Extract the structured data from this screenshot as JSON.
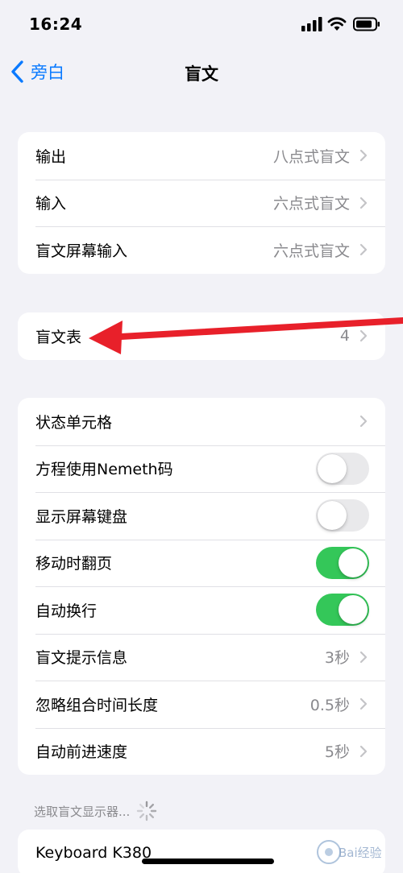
{
  "status_bar": {
    "time": "16:24",
    "icons": [
      "signal-icon",
      "wifi-icon",
      "battery-icon"
    ]
  },
  "nav": {
    "back_label": "旁白",
    "title": "盲文"
  },
  "group1": {
    "rows": [
      {
        "label": "输出",
        "value": "八点式盲文"
      },
      {
        "label": "输入",
        "value": "六点式盲文"
      },
      {
        "label": "盲文屏幕输入",
        "value": "六点式盲文"
      }
    ]
  },
  "group2": {
    "rows": [
      {
        "label": "盲文表",
        "value": "4"
      }
    ]
  },
  "group3": {
    "rows": [
      {
        "label": "状态单元格",
        "value": ""
      },
      {
        "label": "方程使用Nemeth码",
        "toggle": false
      },
      {
        "label": "显示屏幕键盘",
        "toggle": false
      },
      {
        "label": "移动时翻页",
        "toggle": true
      },
      {
        "label": "自动换行",
        "toggle": true
      },
      {
        "label": "盲文提示信息",
        "value": "3秒"
      },
      {
        "label": "忽略组合时间长度",
        "value": "0.5秒"
      },
      {
        "label": "自动前进速度",
        "value": "5秒"
      }
    ]
  },
  "section4": {
    "header": "选取盲文显示器...",
    "rows": [
      {
        "label": "Keyboard K380"
      }
    ]
  },
  "colors": {
    "accent": "#0a7aff",
    "toggle_on": "#34c759",
    "toggle_off": "#e9e9eb",
    "annotation_arrow": "#e8202a"
  },
  "watermark": "Bai经验"
}
